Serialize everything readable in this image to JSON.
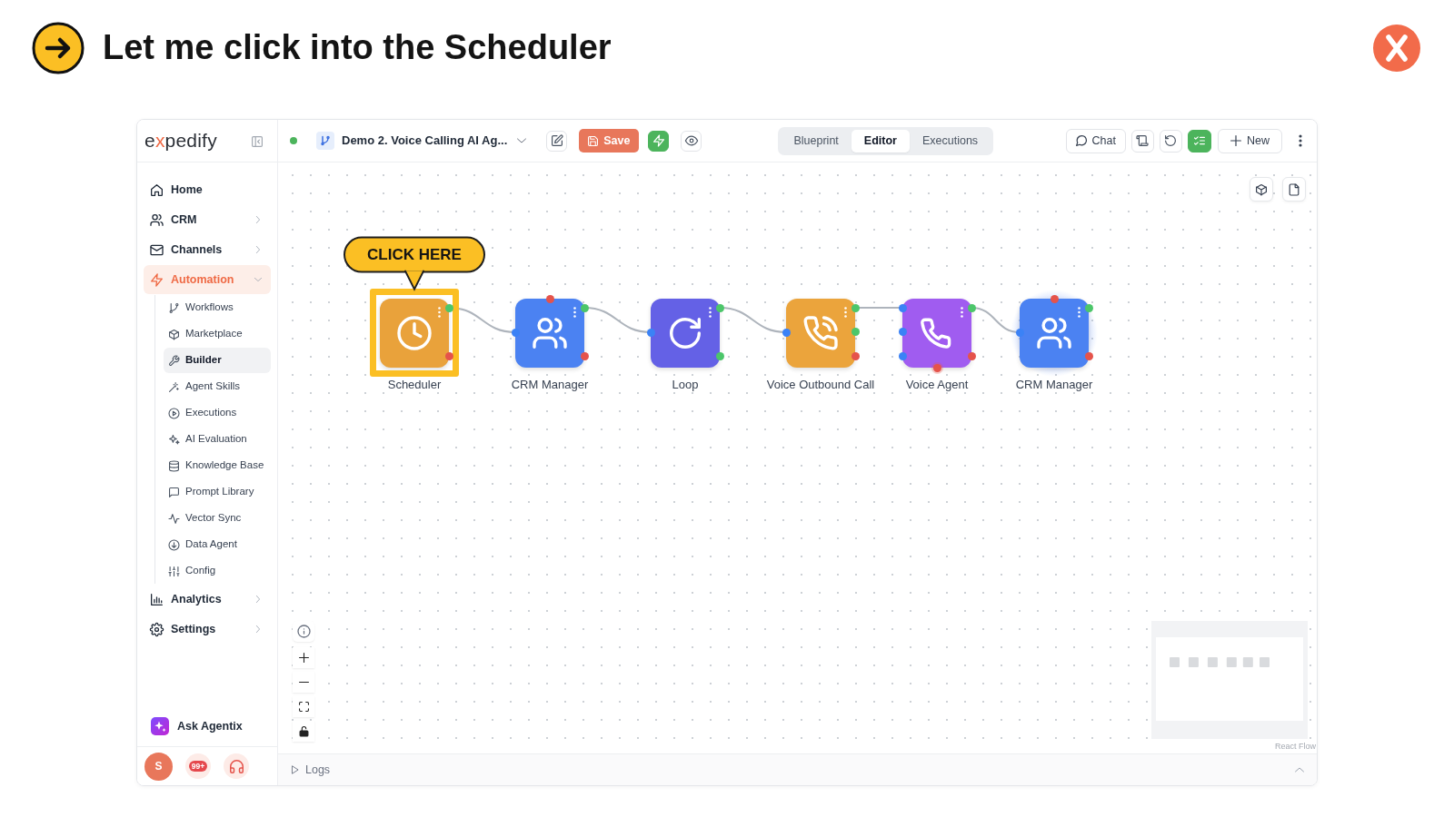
{
  "header": {
    "title": "Let me click into the Scheduler"
  },
  "sidebar": {
    "logo": [
      {
        "text": "e",
        "color": "#2b2f36"
      },
      {
        "text": "x",
        "color": "#ef6a45"
      },
      {
        "text": "pedify",
        "color": "#2b2f36"
      }
    ],
    "items": [
      {
        "label": "Home",
        "selected": false
      },
      {
        "label": "CRM",
        "selected": false,
        "expanded": false
      },
      {
        "label": "Channels",
        "selected": false,
        "expanded": false
      },
      {
        "label": "Automation",
        "selected": true,
        "expanded": true,
        "children": [
          {
            "label": "Workflows",
            "selected": false
          },
          {
            "label": "Marketplace",
            "selected": false
          },
          {
            "label": "Builder",
            "selected": true
          },
          {
            "label": "Agent Skills",
            "selected": false
          },
          {
            "label": "Executions",
            "selected": false
          },
          {
            "label": "AI Evaluation",
            "selected": false
          },
          {
            "label": "Knowledge Base",
            "selected": false
          },
          {
            "label": "Prompt Library",
            "selected": false
          },
          {
            "label": "Vector Sync",
            "selected": false
          },
          {
            "label": "Data Agent",
            "selected": false
          },
          {
            "label": "Config",
            "selected": false
          }
        ]
      },
      {
        "label": "Analytics",
        "selected": false,
        "expanded": false
      },
      {
        "label": "Settings",
        "selected": false,
        "expanded": false
      }
    ],
    "assistant": {
      "label": "Ask Agentix"
    },
    "footer": {
      "avatar": "S",
      "notifications": "99+"
    }
  },
  "toolbar": {
    "workflow": {
      "active": true,
      "name": "Demo 2. Voice Calling AI Ag..."
    },
    "save": "Save",
    "tabs": [
      {
        "label": "Blueprint",
        "selected": false
      },
      {
        "label": "Editor",
        "selected": true
      },
      {
        "label": "Executions",
        "selected": false
      }
    ],
    "chat": "Chat",
    "new": "New"
  },
  "canvas": {
    "nodes": [
      {
        "kind": "scheduler",
        "label": "Scheduler",
        "color": "#e9a23b",
        "highlighted": true,
        "selected": false,
        "callout": "CLICK HERE",
        "edge_to_next": true,
        "ports": {
          "right": [
            {
              "color": "#4cc66a"
            },
            {
              "color": "#e5534b"
            }
          ]
        }
      },
      {
        "kind": "crm",
        "label": "CRM Manager",
        "color": "#4b82f2",
        "highlighted": false,
        "selected": false,
        "edge_to_next": true,
        "ports": {
          "top": [
            {
              "color": "#e5534b"
            }
          ],
          "left": [
            {
              "color": "#3b82f6"
            }
          ],
          "right": [
            {
              "color": "#4cc66a"
            },
            {
              "color": "#e5534b"
            }
          ]
        }
      },
      {
        "kind": "loop",
        "label": "Loop",
        "color": "#6461e6",
        "highlighted": false,
        "selected": false,
        "edge_to_next": true,
        "ports": {
          "left": [
            {
              "color": "#3b82f6"
            }
          ],
          "right": [
            {
              "color": "#4cc66a"
            },
            {
              "color": "#4cc66a"
            }
          ]
        }
      },
      {
        "kind": "voice_call",
        "label": "Voice Outbound Call",
        "color": "#eba43c",
        "highlighted": false,
        "selected": false,
        "edge_to_next": true,
        "ports": {
          "left": [
            {
              "color": "#3b82f6"
            }
          ],
          "right": [
            {
              "color": "#4cc66a"
            },
            {
              "color": "#4cc66a"
            },
            {
              "color": "#e5534b"
            }
          ]
        }
      },
      {
        "kind": "voice_agent",
        "label": "Voice Agent",
        "color": "#a05cf0",
        "highlighted": false,
        "selected": false,
        "edge_to_next": true,
        "ports": {
          "left": [
            {
              "color": "#3b82f6"
            },
            {
              "color": "#3b82f6"
            },
            {
              "color": "#3b82f6"
            }
          ],
          "right": [
            {
              "color": "#4cc66a"
            },
            {
              "color": "#e5534b"
            }
          ],
          "bottom": [
            {
              "color": "#e5534b"
            }
          ]
        }
      },
      {
        "kind": "crm",
        "label": "CRM Manager",
        "color": "#4b82f2",
        "highlighted": false,
        "selected": true,
        "edge_to_next": false,
        "ports": {
          "top": [
            {
              "color": "#e5534b"
            }
          ],
          "left": [
            {
              "color": "#3b82f6"
            }
          ],
          "right": [
            {
              "color": "#4cc66a"
            },
            {
              "color": "#e5534b"
            }
          ]
        }
      }
    ],
    "attribution": "React Flow"
  },
  "logs": {
    "label": "Logs",
    "expanded": false
  }
}
